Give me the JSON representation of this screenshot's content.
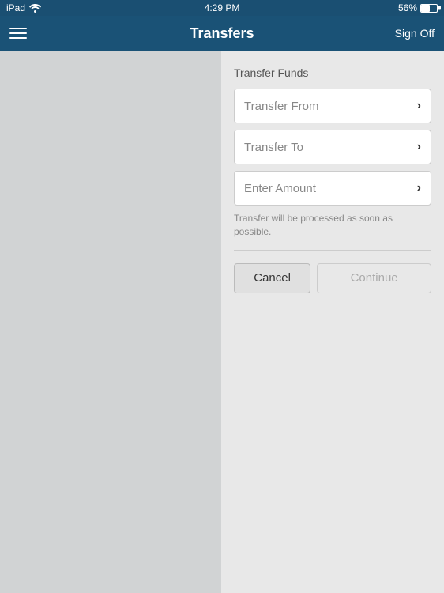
{
  "statusBar": {
    "device": "iPad",
    "wifi": "wifi-icon",
    "time": "4:29 PM",
    "battery_percent": "56%",
    "battery_icon": "battery-icon"
  },
  "navBar": {
    "menu_icon": "menu-icon",
    "title": "Transfers",
    "signoff_label": "Sign Off"
  },
  "form": {
    "section_title": "Transfer Funds",
    "transfer_from_label": "Transfer From",
    "transfer_to_label": "Transfer To",
    "enter_amount_label": "Enter Amount",
    "helper_text": "Transfer will be processed as soon as possible."
  },
  "buttons": {
    "cancel_label": "Cancel",
    "continue_label": "Continue"
  }
}
